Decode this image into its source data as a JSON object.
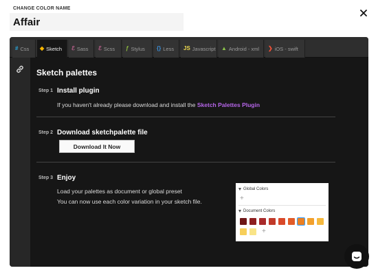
{
  "header": {
    "label": "CHANGE COLOR NAME",
    "color_name": "Affair"
  },
  "tabs": [
    {
      "label": "Css",
      "icon": "#",
      "icon_name": "hash-icon",
      "icon_color": "#29a9df"
    },
    {
      "label": "Sketch",
      "icon": "◆",
      "icon_name": "sketch-diamond-icon",
      "icon_color": "#f7b500"
    },
    {
      "label": "Sass",
      "icon": "ℰ",
      "icon_name": "sass-icon",
      "icon_color": "#cd6799"
    },
    {
      "label": "Scss",
      "icon": "ℰ",
      "icon_name": "scss-icon",
      "icon_color": "#cd6799"
    },
    {
      "label": "Stylus",
      "icon": "ƒ",
      "icon_name": "stylus-icon",
      "icon_color": "#8fbd3f"
    },
    {
      "label": "Less",
      "icon": "{}",
      "icon_name": "less-braces-icon",
      "icon_color": "#3b8ed8"
    },
    {
      "label": "Javascript",
      "icon": "JS",
      "icon_name": "javascript-icon",
      "icon_color": "#f0db4f"
    },
    {
      "label": "Android - xml",
      "icon": "▲",
      "icon_name": "android-icon",
      "icon_color": "#8bc34a"
    },
    {
      "label": "iOS - swift",
      "icon": "❯",
      "icon_name": "swift-icon",
      "icon_color": "#f05138"
    }
  ],
  "content": {
    "title": "Sketch palettes",
    "steps": [
      {
        "label": "Step 1",
        "title": "Install plugin",
        "text": "If you haven't already please download and install the ",
        "link": "Sketch Palettes Plugin"
      },
      {
        "label": "Step 2",
        "title": "Download sketchpalette file",
        "button": "Download It Now"
      },
      {
        "label": "Step 3",
        "title": "Enjoy",
        "text_line1": "Load your palettes as document or global preset",
        "text_line2": "You can now use each color variation in your sketch file."
      }
    ]
  },
  "preview": {
    "global_label": "Global Colors",
    "document_label": "Document Colors",
    "plus": "+",
    "swatches": [
      "#6e1717",
      "#8e1f1f",
      "#a92b2b",
      "#c13a2a",
      "#d9492a",
      "#e25c28",
      "#ea7f22",
      "#f2a02c",
      "#f5b93e",
      "#f7cf5a",
      "#f9e487"
    ]
  },
  "colors": {
    "accent_link": "#b565e8",
    "panel_bg": "#1c1c1c",
    "tabbar_bg": "#2e2e2e"
  }
}
